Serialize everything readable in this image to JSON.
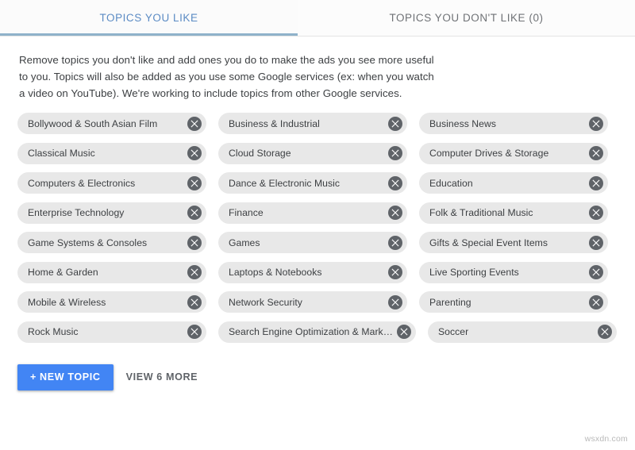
{
  "tabs": [
    {
      "id": "topics-you-like",
      "label": "TOPICS YOU LIKE",
      "active": true
    },
    {
      "id": "topics-you-dont-like",
      "label": "TOPICS YOU DON'T LIKE (0)",
      "active": false
    }
  ],
  "description": "Remove topics you don't like and add ones you do to make the ads you see more useful to you. Topics will also be added as you use some Google services (ex: when you watch a video on YouTube). We're working to include topics from other Google services.",
  "chip_remove_icon": "close-circle-icon",
  "topic_rows": [
    [
      "Bollywood & South Asian Film",
      "Business & Industrial",
      "Business News"
    ],
    [
      "Classical Music",
      "Cloud Storage",
      "Computer Drives & Storage"
    ],
    [
      "Computers & Electronics",
      "Dance & Electronic Music",
      "Education"
    ],
    [
      "Enterprise Technology",
      "Finance",
      "Folk & Traditional Music"
    ],
    [
      "Game Systems & Consoles",
      "Games",
      "Gifts & Special Event Items"
    ],
    [
      "Home & Garden",
      "Laptops & Notebooks",
      "Live Sporting Events"
    ],
    [
      "Mobile & Wireless",
      "Network Security",
      "Parenting"
    ],
    [
      "Rock Music",
      "Search Engine Optimization & Mark…",
      "Soccer"
    ]
  ],
  "actions": {
    "new_topic_label": "+ NEW TOPIC",
    "view_more_label": "VIEW 6 MORE"
  },
  "watermark": "wsxdn.com",
  "colors": {
    "accent_blue": "#4285f4",
    "tab_active": "#5b8bc4",
    "tab_underline": "#8fb2ca",
    "chip_bg": "#e8e8e8",
    "chip_remove": "#5f6368"
  }
}
